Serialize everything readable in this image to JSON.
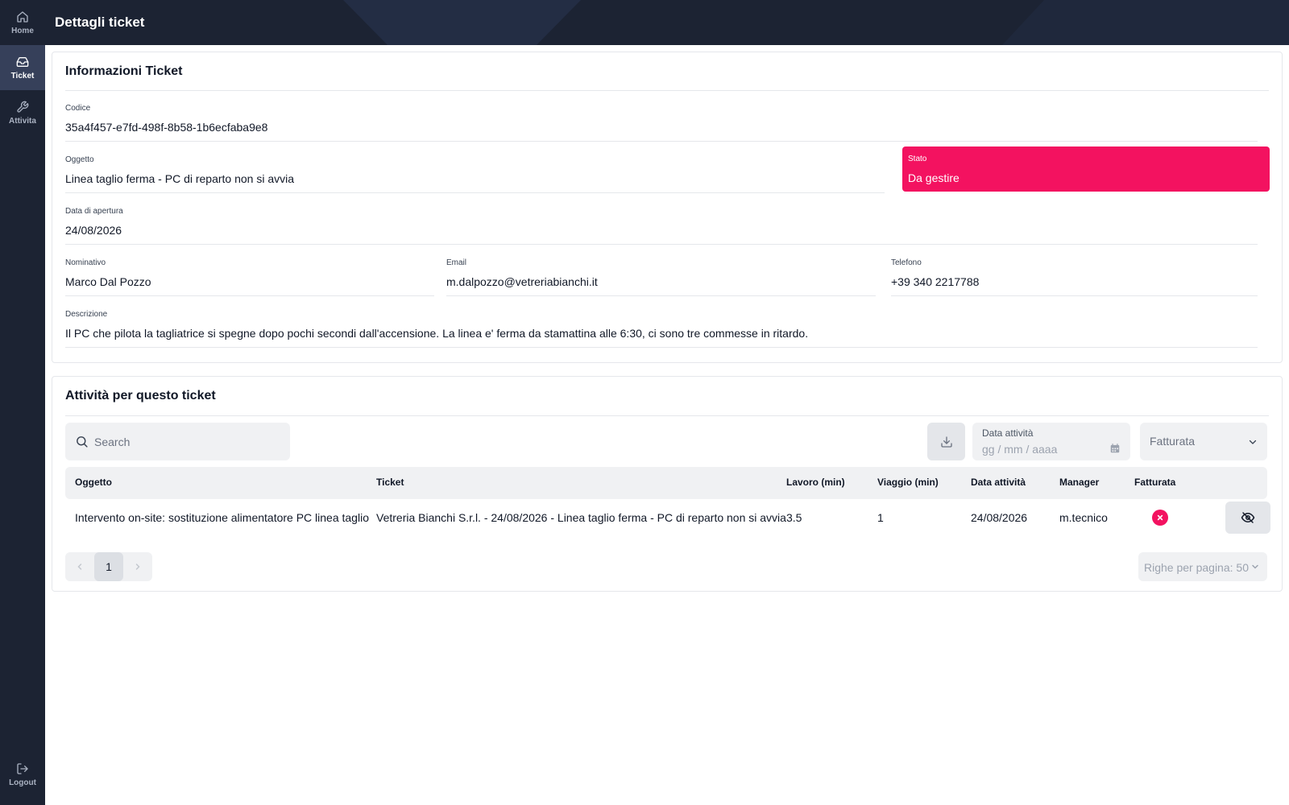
{
  "sidebar": {
    "items": [
      {
        "label": "Home",
        "icon": "home-icon"
      },
      {
        "label": "Ticket",
        "icon": "inbox-icon",
        "active": true
      },
      {
        "label": "Attivita",
        "icon": "wrench-icon"
      }
    ],
    "logout": {
      "label": "Logout",
      "icon": "logout-icon"
    }
  },
  "header": {
    "title": "Dettagli ticket"
  },
  "ticket_info": {
    "title": "Informazioni Ticket",
    "codice": {
      "label": "Codice",
      "value": "35a4f457-e7fd-498f-8b58-1b6ecfaba9e8"
    },
    "oggetto": {
      "label": "Oggetto",
      "value": "Linea taglio ferma - PC di reparto non si avvia"
    },
    "stato": {
      "label": "Stato",
      "value": "Da gestire",
      "color": "#f31260"
    },
    "data_apertura": {
      "label": "Data di apertura",
      "value": "24/08/2026"
    },
    "nominativo": {
      "label": "Nominativo",
      "value": "Marco Dal Pozzo"
    },
    "email": {
      "label": "Email",
      "value": "m.dalpozzo@vetreriabianchi.it"
    },
    "telefono": {
      "label": "Telefono",
      "value": "+39 340 2217788"
    },
    "descrizione": {
      "label": "Descrizione",
      "value": "Il PC che pilota la tagliatrice si spegne dopo pochi secondi dall'accensione. La linea e' ferma da stamattina alle 6:30, ci sono tre commesse in ritardo."
    }
  },
  "activities": {
    "title": "Attività per questo ticket",
    "search": {
      "placeholder": "Search",
      "value": ""
    },
    "date_filter": {
      "label": "Data attività",
      "placeholder": "gg / mm / aaaa"
    },
    "fatturata_filter": {
      "value": "Fatturata"
    },
    "columns": [
      "Oggetto",
      "Ticket",
      "Lavoro (min)",
      "Viaggio (min)",
      "Data attività",
      "Manager",
      "Fatturata"
    ],
    "rows": [
      {
        "oggetto": "Intervento on-site: sostituzione alimentatore PC linea taglio",
        "ticket": "Vetreria Bianchi S.r.l. - 24/08/2026 - Linea taglio ferma - PC di reparto non si avvia",
        "lavoro": "3.5",
        "viaggio": "1",
        "data": "24/08/2026",
        "manager": "m.tecnico",
        "fatturata": false
      }
    ],
    "pagination": {
      "current_page": "1",
      "rows_per_page": "Righe per pagina: 50"
    }
  },
  "colors": {
    "sidebar_bg": "#1c2333",
    "accent_danger": "#f31260",
    "surface": "#f0f1f3"
  }
}
